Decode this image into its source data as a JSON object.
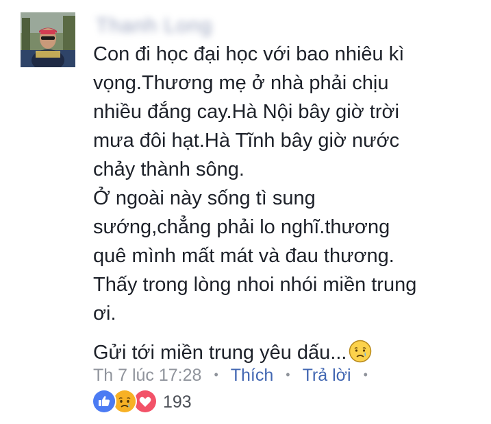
{
  "comment": {
    "author_name": "Thanh Long",
    "avatar_icon": "profile-photo",
    "paragraphs": [
      [
        "Con đi học đại học với bao nhiêu kì",
        "vọng.Thương mẹ ở nhà phải chịu",
        "nhiều đắng cay.Hà Nội bây giờ trời",
        "mưa đôi hạt.Hà Tĩnh bây giờ nước",
        "chảy thành sông.",
        "Ở ngoài này sống tì sung",
        "sướng,chẳng phải lo nghĩ.thương",
        "quê mình mất mát và đau thương.",
        "Thấy trong lòng nhoi nhói miền trung",
        "ơi."
      ],
      [
        "Gửi tới miền trung yêu dấu..."
      ]
    ],
    "trailing_emoji": "crying-face-icon"
  },
  "actions": {
    "timestamp": "Th 7 lúc 17:28",
    "like_label": "Thích",
    "reply_label": "Trả lời",
    "separator": "•"
  },
  "reactions": {
    "icons": [
      "like-icon",
      "sad-icon",
      "love-icon"
    ],
    "count": "193"
  },
  "colors": {
    "text": "#1d2129",
    "muted": "#90949c",
    "link": "#4267b2",
    "like": "#4b7bf3",
    "sad": "#f7b125",
    "love": "#f25268"
  }
}
